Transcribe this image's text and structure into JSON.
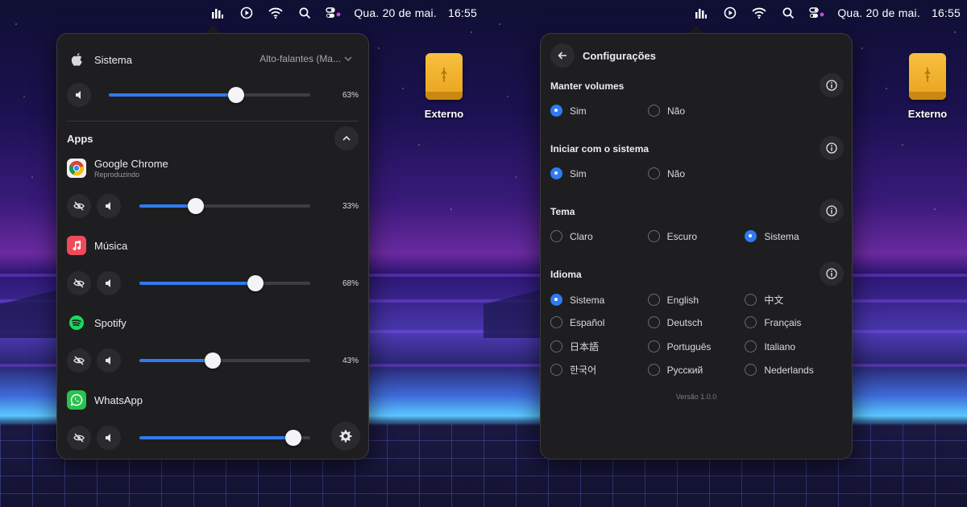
{
  "menubar": {
    "date": "Qua. 20 de mai.",
    "time": "16:55"
  },
  "desktop": {
    "drive_label": "Externo"
  },
  "mixer": {
    "system": {
      "label": "Sistema",
      "output": "Alto-falantes (Ma...",
      "volume": 63,
      "volume_text": "63%"
    },
    "apps_title": "Apps",
    "apps": [
      {
        "name": "Google Chrome",
        "status": "Reproduzindo",
        "icon": "chrome-icon",
        "volume": 33,
        "volume_text": "33%"
      },
      {
        "name": "Música",
        "status": "",
        "icon": "music-icon",
        "volume": 68,
        "volume_text": "68%"
      },
      {
        "name": "Spotify",
        "status": "",
        "icon": "spotify-icon",
        "volume": 43,
        "volume_text": "43%"
      },
      {
        "name": "WhatsApp",
        "status": "",
        "icon": "whatsapp-icon",
        "volume": 90,
        "volume_text": "%"
      }
    ]
  },
  "settings": {
    "title": "Configurações",
    "groups": {
      "keep_volumes": {
        "title": "Manter volumes",
        "options": [
          "Sim",
          "Não"
        ],
        "selected": 0
      },
      "start_with_system": {
        "title": "Iniciar com o sistema",
        "options": [
          "Sim",
          "Não"
        ],
        "selected": 0
      },
      "theme": {
        "title": "Tema",
        "options": [
          "Claro",
          "Escuro",
          "Sistema"
        ],
        "selected": 2
      },
      "language": {
        "title": "Idioma",
        "options": [
          "Sistema",
          "English",
          "中文",
          "Español",
          "Deutsch",
          "Français",
          "日本語",
          "Português",
          "Italiano",
          "한국어",
          "Русский",
          "Nederlands"
        ],
        "selected": 0
      }
    },
    "version": "Versão 1.0.0"
  },
  "colors": {
    "accent": "#2f7bf0",
    "panel": "#1e1e20",
    "button": "#2b2b2e"
  }
}
